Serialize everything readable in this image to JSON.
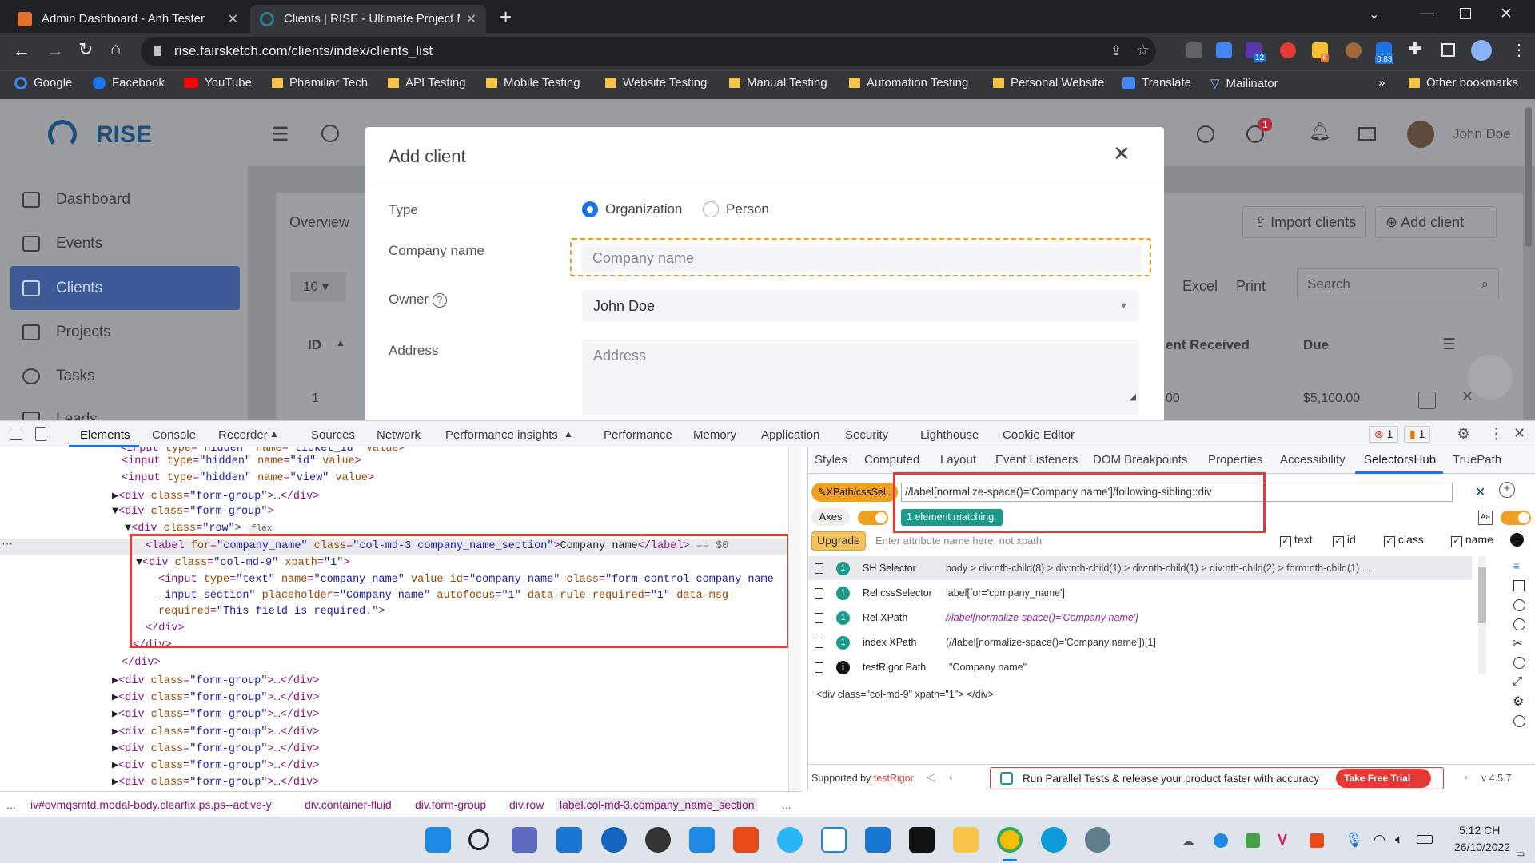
{
  "browser": {
    "tabs": [
      {
        "title": "Admin Dashboard - Anh Tester"
      },
      {
        "title": "Clients | RISE - Ultimate Project M"
      }
    ],
    "url": "rise.fairsketch.com/clients/index/clients_list",
    "ext_badges": {
      "b1": "12",
      "b2": "6",
      "b3": "0.83"
    },
    "bookmarks": [
      "Google",
      "Facebook",
      "YouTube",
      "Phamiliar Tech",
      "API Testing",
      "Mobile Testing",
      "Website Testing",
      "Manual Testing",
      "Automation Testing",
      "Personal Website",
      "Translate",
      "Mailinator"
    ],
    "other_bookmarks": "Other bookmarks",
    "more": "»"
  },
  "app": {
    "logo": "RISE",
    "user": "John Doe",
    "notif_count": "1",
    "sidebar": [
      "Dashboard",
      "Events",
      "Clients",
      "Projects",
      "Tasks",
      "Leads"
    ],
    "overview": "Overview",
    "import_clients": "Import clients",
    "add_client": "Add client",
    "page_size": "10",
    "excel": "Excel",
    "print": "Print",
    "search_placeholder": "Search",
    "col_id": "ID",
    "col_payment": "ent Received",
    "col_due": "Due",
    "row_id": "1",
    "row_paid": "00",
    "row_due": "$5,100.00"
  },
  "modal": {
    "title": "Add client",
    "type_label": "Type",
    "type_org": "Organization",
    "type_person": "Person",
    "company_label": "Company name",
    "company_placeholder": "Company name",
    "owner_label": "Owner",
    "owner_value": "John Doe",
    "address_label": "Address",
    "address_placeholder": "Address"
  },
  "devtools": {
    "tabs": [
      "Elements",
      "Console",
      "Recorder",
      "Sources",
      "Network",
      "Performance insights",
      "Performance",
      "Memory",
      "Application",
      "Security",
      "Lighthouse",
      "Cookie Editor"
    ],
    "errors": "1",
    "warnings": "1",
    "side_tabs": [
      "Styles",
      "Computed",
      "Layout",
      "Event Listeners",
      "DOM Breakpoints",
      "Properties",
      "Accessibility",
      "SelectorsHub",
      "TruePath"
    ],
    "breadcrumbs": [
      "...",
      "iv#ovmqsmtd.modal-body.clearfix.ps.ps--active-y",
      "div.container-fluid",
      "div.form-group",
      "div.row",
      "label.col-md-3.company_name_section",
      "..."
    ],
    "sh": {
      "mode": "XPath/cssSel..",
      "query": "//label[normalize-space()='Company name']/following-sibling::div",
      "match": "1 element matching.",
      "axes": "Axes",
      "upgrade": "Upgrade",
      "attr_placeholder": "Enter attribute name here, not xpath",
      "checks": [
        "text",
        "id",
        "class",
        "name"
      ],
      "rows": [
        {
          "count": "1",
          "label": "SH Selector",
          "value": "body > div:nth-child(8) > div:nth-child(1) > div:nth-child(1) > div:nth-child(2) > form:nth-child(1) ..."
        },
        {
          "count": "1",
          "label": "Rel cssSelector",
          "value": "label[for='company_name']"
        },
        {
          "count": "1",
          "label": "Rel XPath",
          "value": "//label[normalize-space()='Company name']"
        },
        {
          "count": "1",
          "label": "index XPath",
          "value": "(//label[normalize-space()='Company name'])[1]"
        },
        {
          "count": "i",
          "label": "testRigor Path",
          "value": "\"Company name\""
        }
      ],
      "result": "<div class=\"col-md-9\" xpath=\"1\"> </div>",
      "supported": "Supported by",
      "testrigor": "testRigor",
      "promo": "Run Parallel Tests & release your product faster with accuracy",
      "trial": "Take Free Trial",
      "version": "v 4.5.7"
    }
  },
  "taskbar": {
    "time": "5:12 CH",
    "date": "26/10/2022"
  }
}
